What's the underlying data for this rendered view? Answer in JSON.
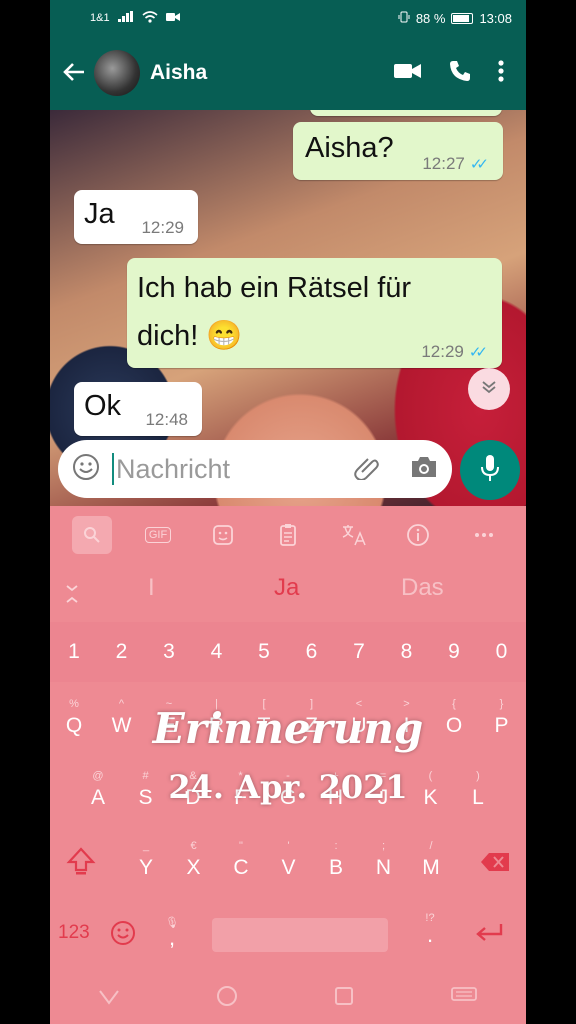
{
  "status_bar": {
    "carrier": "1&1",
    "battery": "88 %",
    "time": "13:08"
  },
  "header": {
    "contact_name": "Aisha",
    "icons": [
      "back-arrow-icon",
      "avatar",
      "video-call-icon",
      "phone-icon",
      "more-vert-icon"
    ]
  },
  "messages": [
    {
      "direction": "out",
      "text": "Aisha?",
      "time": "12:27",
      "read": true
    },
    {
      "direction": "in",
      "text": "Ja",
      "time": "12:29"
    },
    {
      "direction": "out",
      "text_line1": "Ich hab ein Rätsel für",
      "text_line2": "dich! 😁",
      "time": "12:29",
      "read": true
    },
    {
      "direction": "in",
      "text": "Ok",
      "time": "12:48"
    }
  ],
  "composer": {
    "placeholder": "Nachricht"
  },
  "keyboard": {
    "toolbar": [
      "search-icon",
      "gif-icon",
      "sticker-icon",
      "clipboard-icon",
      "translate-icon",
      "info-icon",
      "more-icon"
    ],
    "gif_label": "GIF",
    "suggestions": {
      "left": "I",
      "center": "Ja",
      "right": "Das"
    },
    "digits": [
      "1",
      "2",
      "3",
      "4",
      "5",
      "6",
      "7",
      "8",
      "9",
      "0"
    ],
    "row_q": [
      "Q",
      "W",
      "E",
      "R",
      "T",
      "Z",
      "U",
      "I",
      "O",
      "P"
    ],
    "row_q_sub": [
      "%",
      "^",
      "~",
      "|",
      "[",
      "]",
      "<",
      ">",
      "{",
      "}"
    ],
    "row_a": [
      "A",
      "S",
      "D",
      "F",
      "G",
      "H",
      "J",
      "K",
      "L"
    ],
    "row_a_sub": [
      "@",
      "#",
      "&",
      "*",
      "-",
      "+",
      "=",
      "(",
      ")"
    ],
    "row_y": [
      "Y",
      "X",
      "C",
      "V",
      "B",
      "N",
      "M"
    ],
    "row_y_sub": [
      "_",
      "€",
      "\"",
      "'",
      ":",
      ";",
      "/"
    ],
    "num_label": "123",
    "punct_left": ",",
    "punct_right": ".",
    "punct_right_sub": "!?"
  },
  "overlay": {
    "title": "Erinnerung",
    "date": "24. Apr. 2021"
  },
  "colors": {
    "whatsapp_green": "#075e54",
    "outgoing_bubble": "#e2f7cb",
    "keyboard_bg": "#ee8a93",
    "tick_blue": "#34b7f1",
    "accent_red": "#e23b4d"
  }
}
